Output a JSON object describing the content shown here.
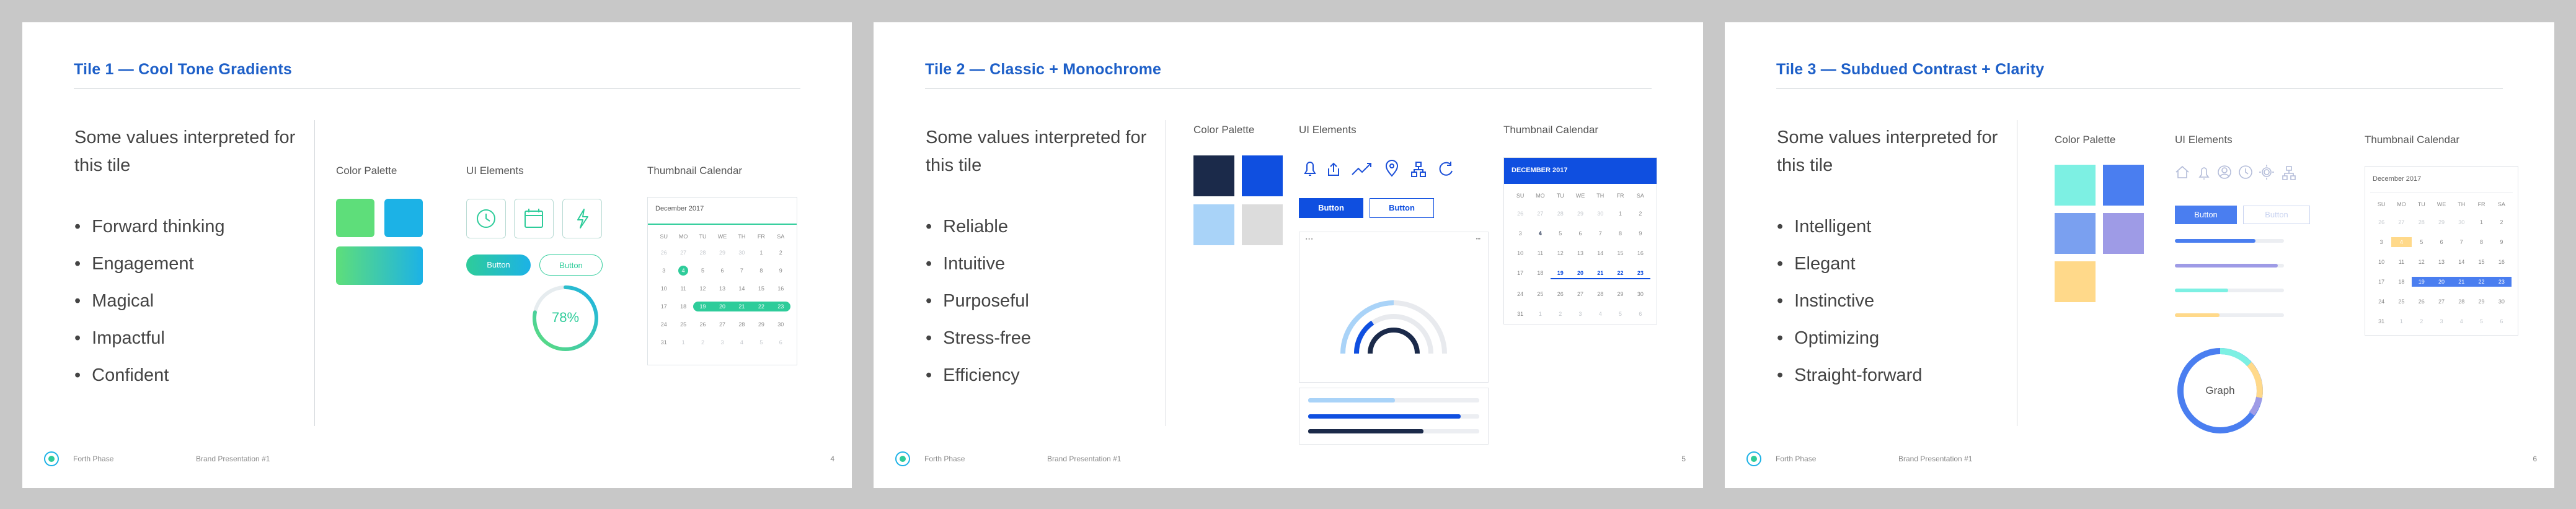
{
  "tiles": [
    {
      "title": "Tile 1 — Cool Tone Gradients",
      "intro": "Some values interpreted for this tile",
      "bullets": [
        "Forward thinking",
        "Engagement",
        "Magical",
        "Impactful",
        "Confident"
      ],
      "color_palette_label": "Color Palette",
      "ui_elements_label": "UI Elements",
      "thumbnail_calendar_label": "Thumbnail Calendar",
      "calendar_month": "December 2017",
      "button_label_1": "Button",
      "button_label_2": "Button",
      "progress_text": "78%",
      "progress_value": 0.78,
      "icons": [
        "clock-icon",
        "calendar-icon",
        "lightning-icon"
      ],
      "colors": {
        "green": "#5ede7a",
        "cyan": "#1cb2e6",
        "accent": "#2ecc9a"
      },
      "page_number": "4"
    },
    {
      "title": "Tile 2 — Classic + Monochrome",
      "intro": "Some values interpreted for this tile",
      "bullets": [
        "Reliable",
        "Intuitive",
        "Purposeful",
        "Stress-free",
        "Efficiency"
      ],
      "color_palette_label": "Color Palette",
      "ui_elements_label": "UI Elements",
      "thumbnail_calendar_label": "Thumbnail Calendar",
      "calendar_month": "DECEMBER 2017",
      "button_label_1": "Button",
      "button_label_2": "Button",
      "icons": [
        "bell-icon",
        "share-icon",
        "trend-icon",
        "location-icon",
        "sitemap-icon",
        "refresh-icon"
      ],
      "colors": {
        "navy": "#1b2a4a",
        "blue": "#0f4fe0",
        "light_blue": "#a9d3f8",
        "grey": "#dcdcdc"
      },
      "page_number": "5"
    },
    {
      "title": "Tile 3 — Subdued Contrast + Clarity",
      "intro": "Some values interpreted for this tile",
      "bullets": [
        "Intelligent",
        "Elegant",
        "Instinctive",
        "Optimizing",
        "Straight-forward"
      ],
      "color_palette_label": "Color Palette",
      "ui_elements_label": "UI Elements",
      "thumbnail_calendar_label": "Thumbnail Calendar",
      "calendar_month": "December 2017",
      "button_label_1": "Button",
      "button_label_2": "Button",
      "graph_label": "Graph",
      "icons": [
        "home-icon",
        "bell-icon",
        "user-icon",
        "clock-icon",
        "gear-icon",
        "sitemap-icon"
      ],
      "colors": {
        "aqua": "#7df0e3",
        "blue": "#4a7ef0",
        "periwinkle": "#7aa0f0",
        "lavender": "#9e9be6",
        "yellow": "#ffd98a"
      },
      "page_number": "6"
    }
  ],
  "footer": {
    "brand": "Forth Phase",
    "presentation": "Brand Presentation #1"
  },
  "calendar": {
    "weekdays": [
      "SU",
      "MO",
      "TU",
      "WE",
      "TH",
      "FR",
      "SA"
    ],
    "days": [
      "26",
      "27",
      "28",
      "29",
      "30",
      "1",
      "2",
      "3",
      "4",
      "5",
      "6",
      "7",
      "8",
      "9",
      "10",
      "11",
      "12",
      "13",
      "14",
      "15",
      "16",
      "17",
      "18",
      "19",
      "20",
      "21",
      "22",
      "23",
      "24",
      "25",
      "26",
      "27",
      "28",
      "29",
      "30",
      "31",
      "1",
      "2",
      "3",
      "4",
      "5",
      "6"
    ]
  }
}
